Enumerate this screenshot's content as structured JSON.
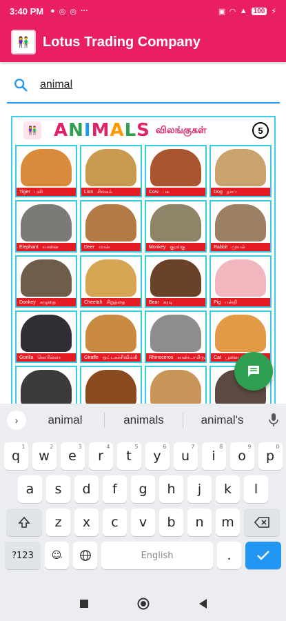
{
  "status": {
    "time": "3:40 PM",
    "battery": "100"
  },
  "app": {
    "title": "Lotus Trading Company"
  },
  "search": {
    "value": "animal"
  },
  "poster": {
    "title_letters": [
      "A",
      "N",
      "I",
      "M",
      "A",
      "L",
      "S"
    ],
    "title_colors": [
      "#e0226a",
      "#2e9e50",
      "#2196f3",
      "#e0226a",
      "#ff9800",
      "#2e9e50",
      "#e0226a"
    ],
    "tamil": "விலங்குகள்",
    "number": "5",
    "cells": [
      {
        "en": "Tiger",
        "ta": "புலி",
        "color": "#d98a3a"
      },
      {
        "en": "Lion",
        "ta": "சிங்கம்",
        "color": "#c79a4f"
      },
      {
        "en": "Cow",
        "ta": "பசு",
        "color": "#a9552f"
      },
      {
        "en": "Dog",
        "ta": "நாய்",
        "color": "#c8a36e"
      },
      {
        "en": "Elephant",
        "ta": "யானை",
        "color": "#7c7a76"
      },
      {
        "en": "Deer",
        "ta": "மான்",
        "color": "#b47a45"
      },
      {
        "en": "Monkey",
        "ta": "குரங்கு",
        "color": "#8e8468"
      },
      {
        "en": "Rabbit",
        "ta": "முயல்",
        "color": "#9b8066"
      },
      {
        "en": "Donkey",
        "ta": "கழுதை",
        "color": "#6f5d4c"
      },
      {
        "en": "Cheetah",
        "ta": "சிறுத்தை",
        "color": "#d6a554"
      },
      {
        "en": "Bear",
        "ta": "கரடி",
        "color": "#6a4227"
      },
      {
        "en": "Pig",
        "ta": "பன்றி",
        "color": "#f1b7bf"
      },
      {
        "en": "Gorilla",
        "ta": "கொரில்லா",
        "color": "#2f2f35"
      },
      {
        "en": "Giraffe",
        "ta": "ஒட்டகச்சிவிங்கி",
        "color": "#c98a42"
      },
      {
        "en": "Rhinoceros",
        "ta": "காண்டாமிருகம்",
        "color": "#8d8d8b"
      },
      {
        "en": "Cat",
        "ta": "பூனை",
        "color": "#e39a47"
      },
      {
        "en": "",
        "ta": "",
        "color": "#3b3b3b"
      },
      {
        "en": "",
        "ta": "",
        "color": "#8a4a20"
      },
      {
        "en": "",
        "ta": "",
        "color": "#c99659"
      },
      {
        "en": "",
        "ta": "",
        "color": "#5a4a42"
      }
    ]
  },
  "keyboard": {
    "suggestions": [
      "animal",
      "animals",
      "animal's"
    ],
    "row1": [
      [
        "q",
        "1"
      ],
      [
        "w",
        "2"
      ],
      [
        "e",
        "3"
      ],
      [
        "r",
        "4"
      ],
      [
        "t",
        "5"
      ],
      [
        "y",
        "6"
      ],
      [
        "u",
        "7"
      ],
      [
        "i",
        "8"
      ],
      [
        "o",
        "9"
      ],
      [
        "p",
        "0"
      ]
    ],
    "row2": [
      "a",
      "s",
      "d",
      "f",
      "g",
      "h",
      "j",
      "k",
      "l"
    ],
    "row3": [
      "z",
      "x",
      "c",
      "v",
      "b",
      "n",
      "m"
    ],
    "num_key": "?123",
    "space_label": "English",
    "period": "."
  }
}
